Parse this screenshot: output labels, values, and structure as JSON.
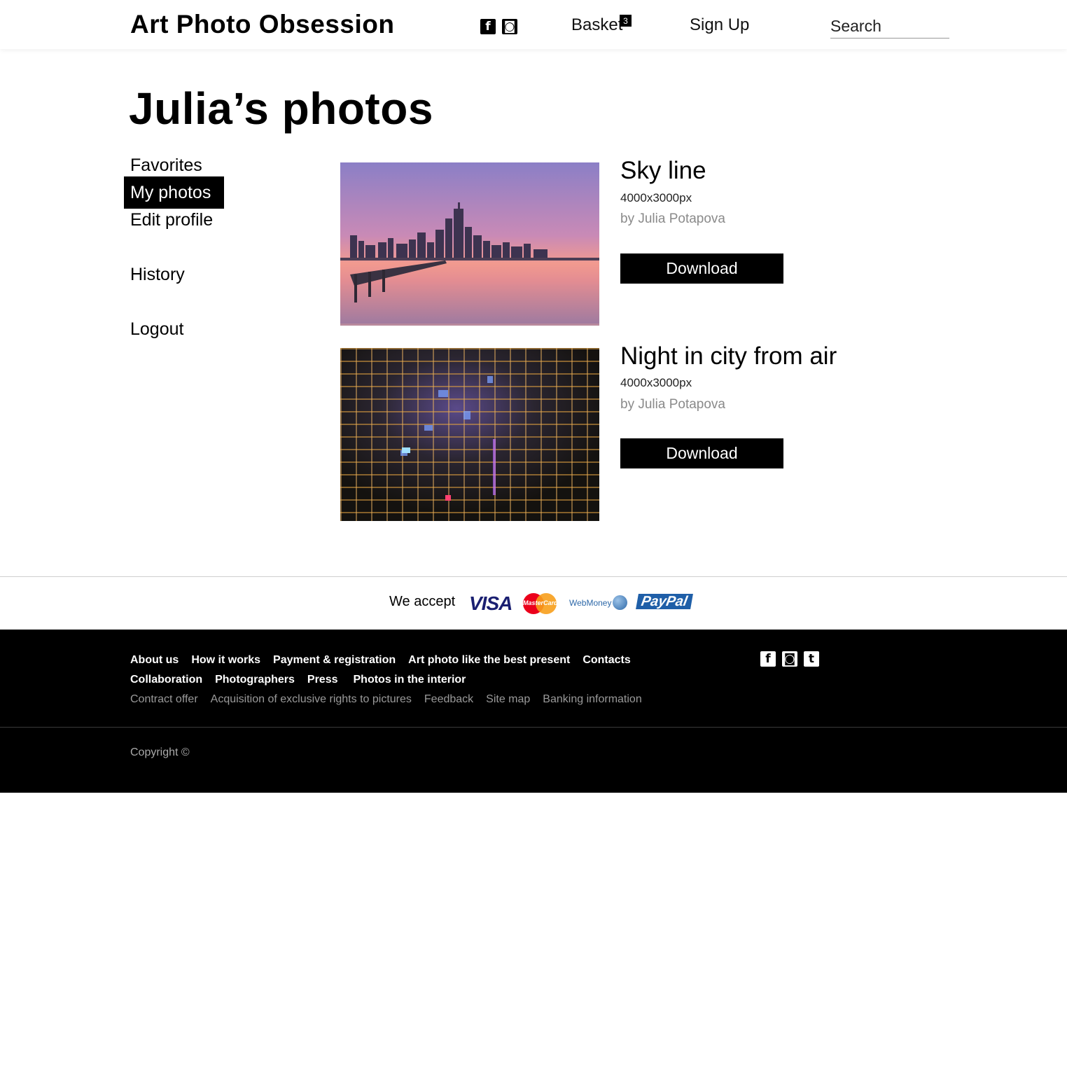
{
  "header": {
    "logo": "Art Photo Obsession",
    "social": [
      {
        "icon": "facebook-icon",
        "glyph": "f"
      },
      {
        "icon": "instagram-icon",
        "glyph": "◙"
      }
    ],
    "basket_label": "Basket",
    "basket_count": "3",
    "signup_label": "Sign Up",
    "search_placeholder": "Search"
  },
  "page_title": "Julia’s photos",
  "sidebar": {
    "items": [
      {
        "label": "Favorites",
        "active": false
      },
      {
        "label": "My photos",
        "active": true
      },
      {
        "label": "Edit profile",
        "active": false
      },
      {
        "label": "History",
        "active": false
      },
      {
        "label": "Logout",
        "active": false
      }
    ]
  },
  "photos": [
    {
      "title": "Sky line",
      "size": "4000x3000px",
      "author": "by Julia Potapova",
      "download_label": "Download"
    },
    {
      "title": "Night in city from air",
      "size": "4000x3000px",
      "author": "by Julia Potapova",
      "download_label": "Download"
    }
  ],
  "payments": {
    "label": "We accept",
    "visa": "VISA",
    "mastercard": "MasterCard",
    "webmoney": "WebMoney",
    "paypal": "PayPal"
  },
  "footer": {
    "row1": [
      "About us",
      "How it works",
      "Payment & registration",
      "Art photo like the best present",
      "Contacts"
    ],
    "row2": [
      "Collaboration",
      "Photographers",
      "Press",
      "Photos in the interior"
    ],
    "row3": [
      "Contract offer",
      "Acquisition of exclusive rights to pictures",
      "Feedback",
      "Site map",
      "Banking information"
    ],
    "social": [
      {
        "icon": "facebook-icon",
        "glyph": "f"
      },
      {
        "icon": "instagram-icon",
        "glyph": "◙"
      },
      {
        "icon": "tumblr-icon",
        "glyph": "t"
      }
    ],
    "copyright": "Copyright ©"
  }
}
